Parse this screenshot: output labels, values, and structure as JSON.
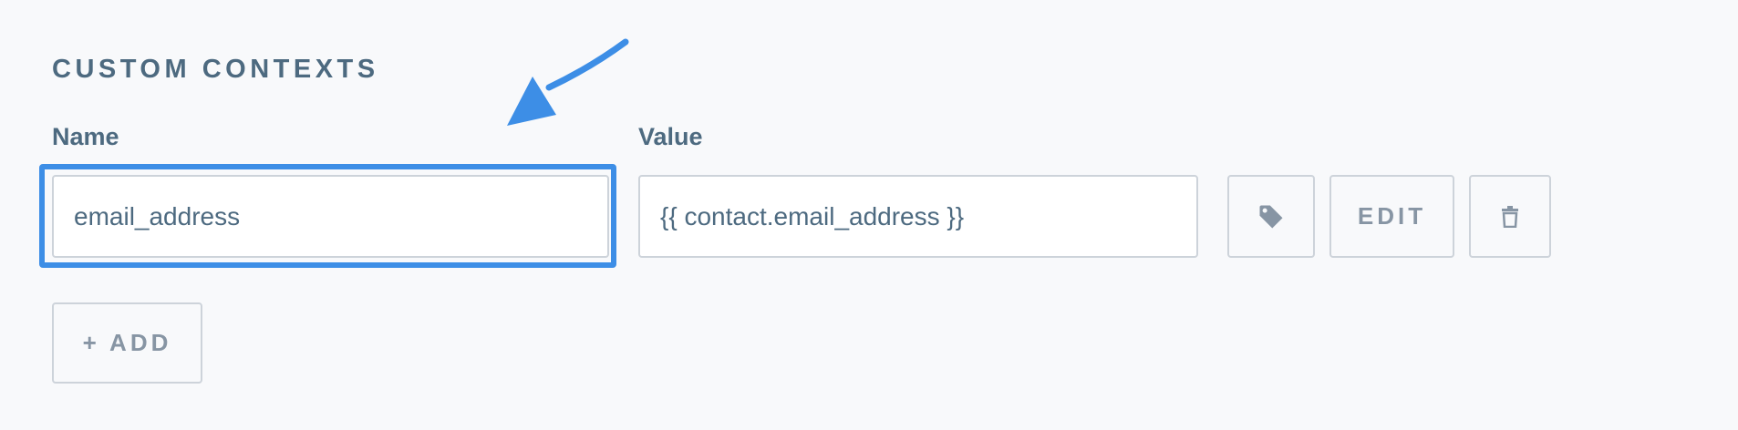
{
  "section": {
    "title": "CUSTOM CONTEXTS"
  },
  "fields": {
    "name_label": "Name",
    "value_label": "Value",
    "name_value": "email_address",
    "value_value": "{{ contact.email_address }}"
  },
  "actions": {
    "edit_label": "EDIT",
    "add_label": "+ ADD"
  },
  "icons": {
    "tag": "tag-icon",
    "trash": "trash-icon",
    "arrow": "arrow-annotation-icon"
  },
  "colors": {
    "highlight": "#3d8ee6",
    "text": "#4d6a80",
    "muted": "#8795a4",
    "border": "#cdd3da",
    "background": "#f8f9fb"
  }
}
